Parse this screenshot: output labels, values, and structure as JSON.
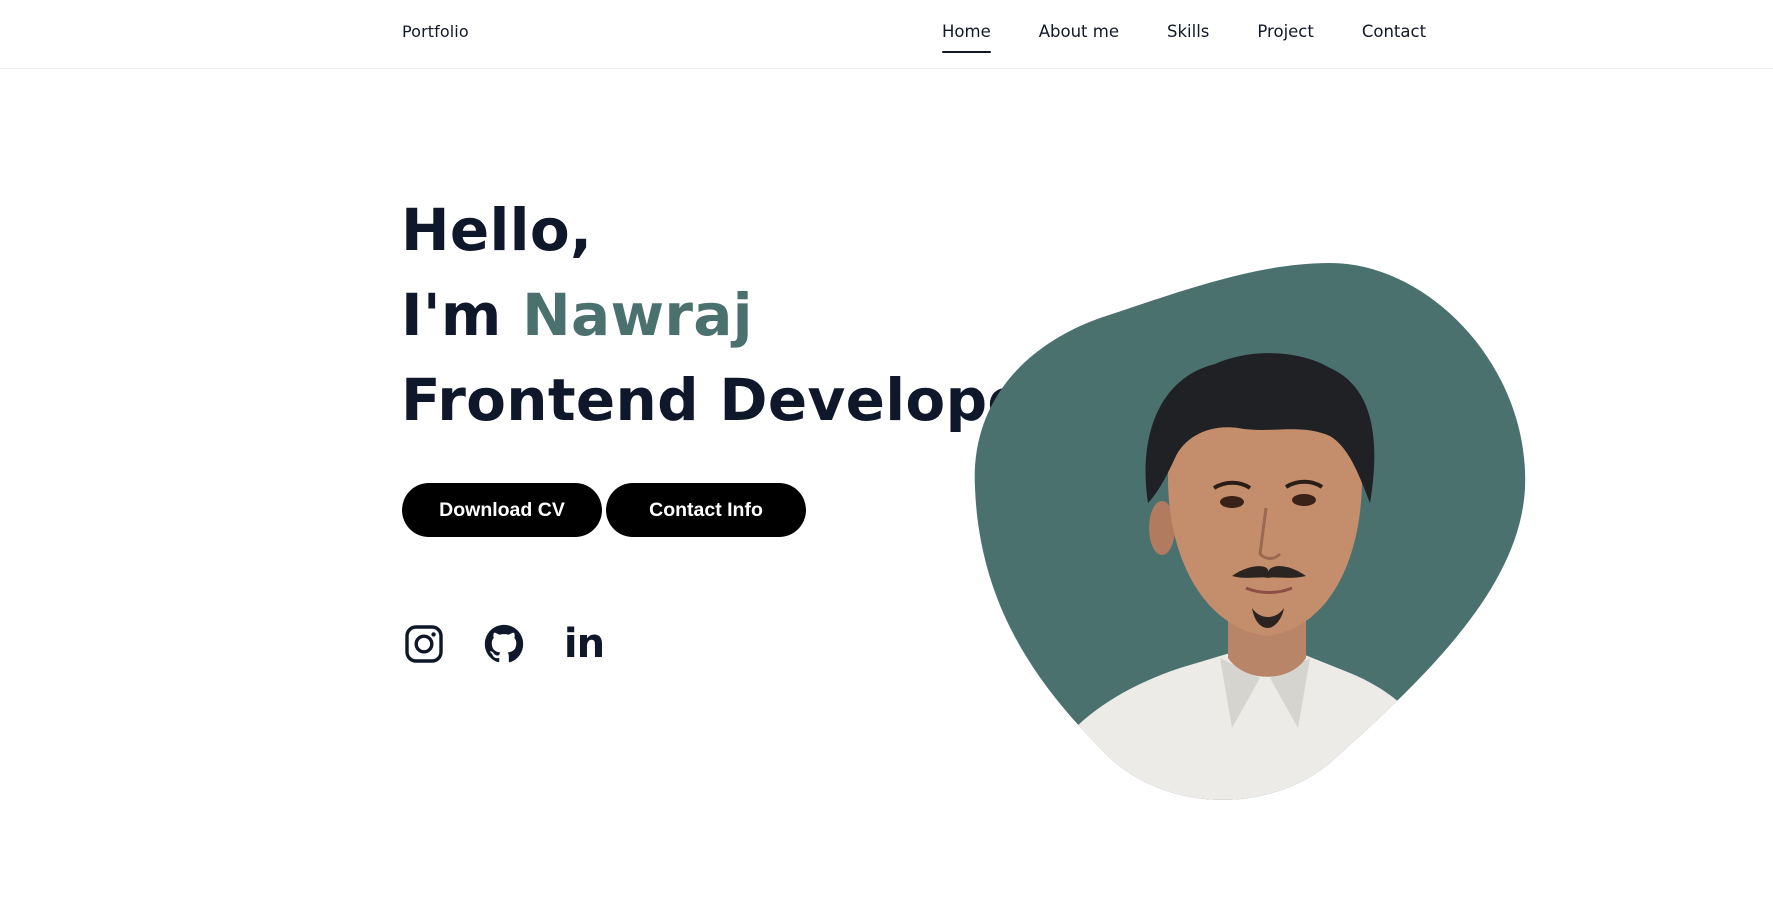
{
  "nav": {
    "brand": "Portfolio",
    "links": [
      "Home",
      "About me",
      "Skills",
      "Project",
      "Contact"
    ],
    "active": "Home"
  },
  "hero": {
    "greeting": "Hello,",
    "intro_prefix": "I'm ",
    "name": "Nawraj",
    "role": "Frontend Developer"
  },
  "buttons": {
    "download_cv": "Download CV",
    "contact_info": "Contact Info"
  },
  "socials": {
    "icons": [
      "instagram-icon",
      "github-icon",
      "linkedin-icon"
    ],
    "linkedin_glyph": "in"
  },
  "colors": {
    "accent": "#4b716f",
    "text": "#0f172a",
    "button_bg": "#000000",
    "button_text": "#ffffff"
  }
}
